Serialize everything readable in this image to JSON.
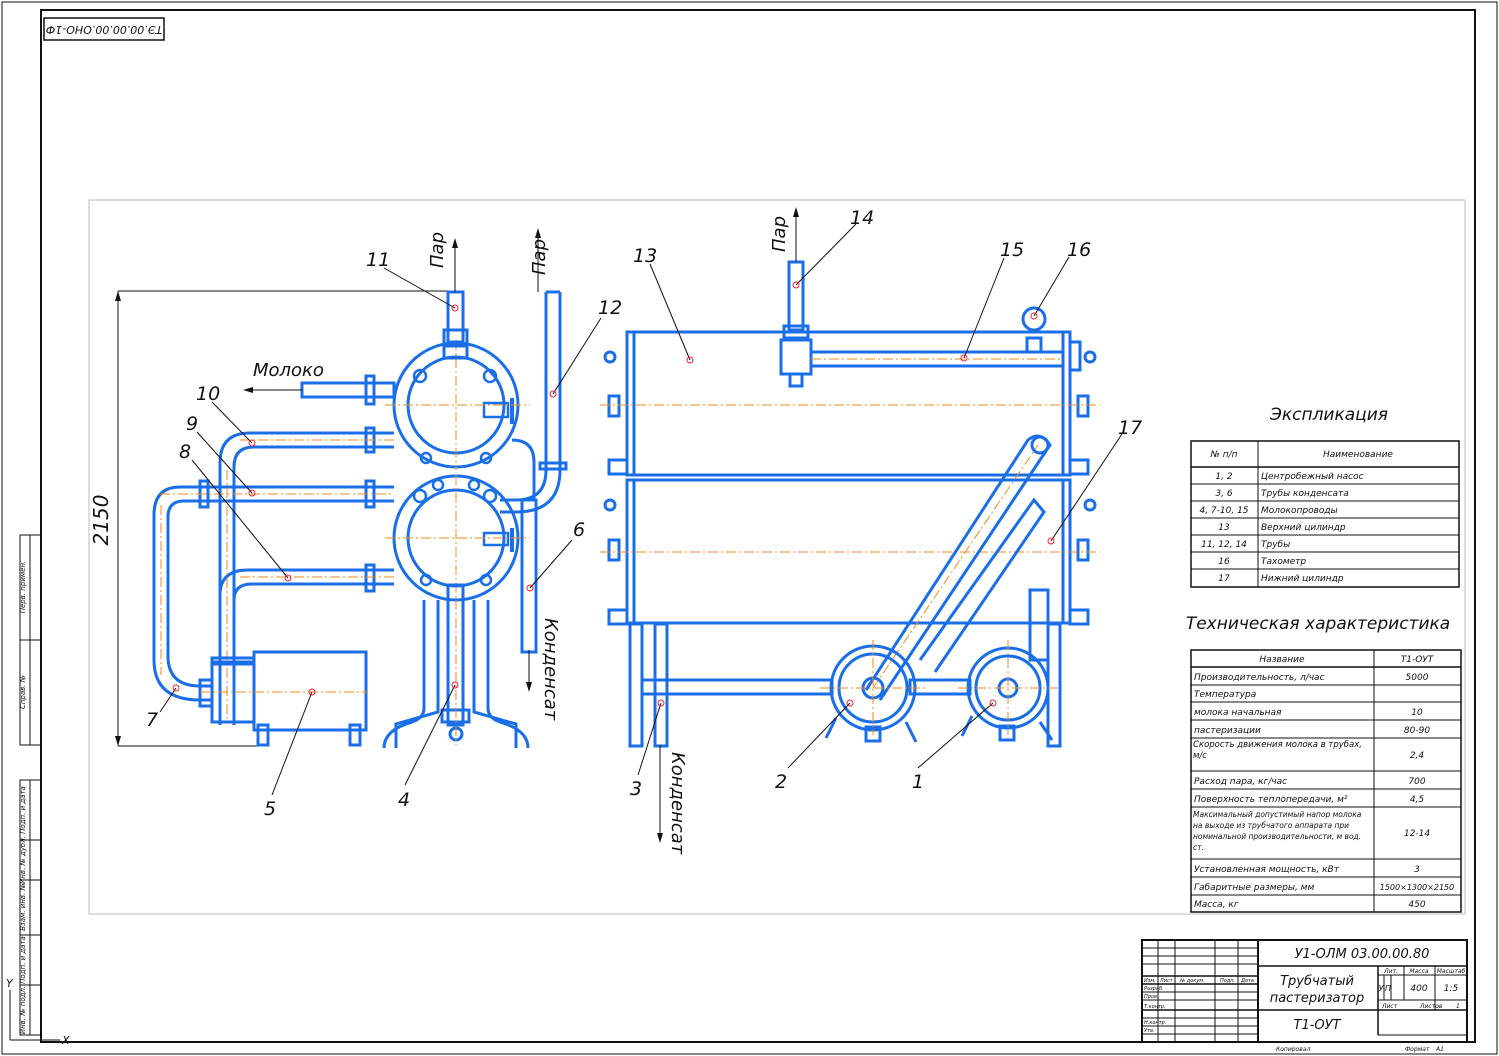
{
  "sheet": {
    "stamp_rotated": "ТЭ.00.00.00.ОНО-1Ф",
    "side_labels": [
      "Перв. примен.",
      "Справ. №",
      "Подп. и дата",
      "Инв. № дубл.",
      "Взам. инв. №",
      "Подп. и дата",
      "Инв. № подл."
    ],
    "axis_y": "Y",
    "axis_x": "X"
  },
  "callouts": [
    "1",
    "2",
    "3",
    "4",
    "5",
    "6",
    "7",
    "8",
    "9",
    "10",
    "11",
    "12",
    "13",
    "14",
    "15",
    "16",
    "17"
  ],
  "flow_labels": {
    "steam_a": "Пар",
    "steam_b": "Пар",
    "steam_c": "Пар",
    "milk": "Молоко",
    "condensate_a": "Конденсат",
    "condensate_b": "Конденсат"
  },
  "dimension": "2150",
  "explication": {
    "title": "Экспликация",
    "headers": [
      "№ п/п",
      "Наименование"
    ],
    "rows": [
      [
        "1, 2",
        "Центробежный насос"
      ],
      [
        "3, 6",
        "Трубы конденсата"
      ],
      [
        "4, 7-10, 15",
        "Молокопроводы"
      ],
      [
        "13",
        "Верхний цилиндр"
      ],
      [
        "11, 12, 14",
        "Трубы"
      ],
      [
        "16",
        "Тахометр"
      ],
      [
        "17",
        "Нижний цилиндр"
      ]
    ]
  },
  "specs": {
    "title": "Техническая характеристика",
    "headers": [
      "Название",
      "Т1-ОУТ"
    ],
    "rows": [
      [
        "Производительность, л/час",
        "5000"
      ],
      [
        "Температура",
        ""
      ],
      [
        "молока начальная",
        "10"
      ],
      [
        "пастеризации",
        "80-90"
      ],
      [
        "Скорость движения молока в трубах, м/с",
        "2,4"
      ],
      [
        "Расход пара, кг/час",
        "700"
      ],
      [
        "Поверхность теплопередачи, м²",
        "4,5"
      ],
      [
        "Максимальный допустимый напор молока на выходе из трубчатого аппарата при номинальной производительности, м вод. ст.",
        "12-14"
      ],
      [
        "Установленная мощность, кВт",
        "3"
      ],
      [
        "Габаритные размеры, мм",
        "1500×1300×2150"
      ],
      [
        "Масса, кг",
        "450"
      ]
    ]
  },
  "title_block": {
    "code": "У1-ОЛМ 03.00.00.80",
    "name_line1": "Трубчатый",
    "name_line2": "пастеризатор",
    "model": "Т1-ОУТ",
    "col_lit": "Лит.",
    "col_mass": "Масса",
    "col_scale": "Масштаб",
    "lit_a": "У",
    "lit_b": "П",
    "mass": "400",
    "scale": "1:5",
    "sheet_label": "Лист",
    "sheets_label": "Листов",
    "sheets_value": "1",
    "roles": [
      "Изм.",
      "Лист",
      "№ докум.",
      "Подп.",
      "Дата",
      "Разраб.",
      "Пров.",
      "Т.контр.",
      "Н.контр.",
      "Утв."
    ],
    "footer_copied": "Копировал",
    "footer_format": "Формат",
    "format": "А1"
  }
}
